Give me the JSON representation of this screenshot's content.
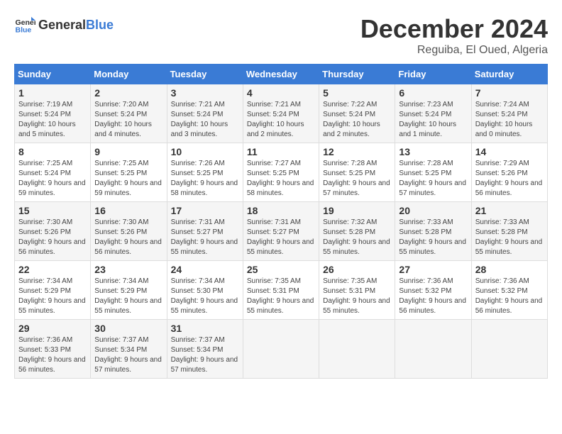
{
  "logo": {
    "general": "General",
    "blue": "Blue"
  },
  "title": "December 2024",
  "subtitle": "Reguiba, El Oued, Algeria",
  "days_header": [
    "Sunday",
    "Monday",
    "Tuesday",
    "Wednesday",
    "Thursday",
    "Friday",
    "Saturday"
  ],
  "weeks": [
    [
      {
        "day": "1",
        "sunrise": "7:19 AM",
        "sunset": "5:24 PM",
        "daylight": "10 hours and 5 minutes."
      },
      {
        "day": "2",
        "sunrise": "7:20 AM",
        "sunset": "5:24 PM",
        "daylight": "10 hours and 4 minutes."
      },
      {
        "day": "3",
        "sunrise": "7:21 AM",
        "sunset": "5:24 PM",
        "daylight": "10 hours and 3 minutes."
      },
      {
        "day": "4",
        "sunrise": "7:21 AM",
        "sunset": "5:24 PM",
        "daylight": "10 hours and 2 minutes."
      },
      {
        "day": "5",
        "sunrise": "7:22 AM",
        "sunset": "5:24 PM",
        "daylight": "10 hours and 2 minutes."
      },
      {
        "day": "6",
        "sunrise": "7:23 AM",
        "sunset": "5:24 PM",
        "daylight": "10 hours and 1 minute."
      },
      {
        "day": "7",
        "sunrise": "7:24 AM",
        "sunset": "5:24 PM",
        "daylight": "10 hours and 0 minutes."
      }
    ],
    [
      {
        "day": "8",
        "sunrise": "7:25 AM",
        "sunset": "5:24 PM",
        "daylight": "9 hours and 59 minutes."
      },
      {
        "day": "9",
        "sunrise": "7:25 AM",
        "sunset": "5:25 PM",
        "daylight": "9 hours and 59 minutes."
      },
      {
        "day": "10",
        "sunrise": "7:26 AM",
        "sunset": "5:25 PM",
        "daylight": "9 hours and 58 minutes."
      },
      {
        "day": "11",
        "sunrise": "7:27 AM",
        "sunset": "5:25 PM",
        "daylight": "9 hours and 58 minutes."
      },
      {
        "day": "12",
        "sunrise": "7:28 AM",
        "sunset": "5:25 PM",
        "daylight": "9 hours and 57 minutes."
      },
      {
        "day": "13",
        "sunrise": "7:28 AM",
        "sunset": "5:25 PM",
        "daylight": "9 hours and 57 minutes."
      },
      {
        "day": "14",
        "sunrise": "7:29 AM",
        "sunset": "5:26 PM",
        "daylight": "9 hours and 56 minutes."
      }
    ],
    [
      {
        "day": "15",
        "sunrise": "7:30 AM",
        "sunset": "5:26 PM",
        "daylight": "9 hours and 56 minutes."
      },
      {
        "day": "16",
        "sunrise": "7:30 AM",
        "sunset": "5:26 PM",
        "daylight": "9 hours and 56 minutes."
      },
      {
        "day": "17",
        "sunrise": "7:31 AM",
        "sunset": "5:27 PM",
        "daylight": "9 hours and 55 minutes."
      },
      {
        "day": "18",
        "sunrise": "7:31 AM",
        "sunset": "5:27 PM",
        "daylight": "9 hours and 55 minutes."
      },
      {
        "day": "19",
        "sunrise": "7:32 AM",
        "sunset": "5:28 PM",
        "daylight": "9 hours and 55 minutes."
      },
      {
        "day": "20",
        "sunrise": "7:33 AM",
        "sunset": "5:28 PM",
        "daylight": "9 hours and 55 minutes."
      },
      {
        "day": "21",
        "sunrise": "7:33 AM",
        "sunset": "5:28 PM",
        "daylight": "9 hours and 55 minutes."
      }
    ],
    [
      {
        "day": "22",
        "sunrise": "7:34 AM",
        "sunset": "5:29 PM",
        "daylight": "9 hours and 55 minutes."
      },
      {
        "day": "23",
        "sunrise": "7:34 AM",
        "sunset": "5:29 PM",
        "daylight": "9 hours and 55 minutes."
      },
      {
        "day": "24",
        "sunrise": "7:34 AM",
        "sunset": "5:30 PM",
        "daylight": "9 hours and 55 minutes."
      },
      {
        "day": "25",
        "sunrise": "7:35 AM",
        "sunset": "5:31 PM",
        "daylight": "9 hours and 55 minutes."
      },
      {
        "day": "26",
        "sunrise": "7:35 AM",
        "sunset": "5:31 PM",
        "daylight": "9 hours and 55 minutes."
      },
      {
        "day": "27",
        "sunrise": "7:36 AM",
        "sunset": "5:32 PM",
        "daylight": "9 hours and 56 minutes."
      },
      {
        "day": "28",
        "sunrise": "7:36 AM",
        "sunset": "5:32 PM",
        "daylight": "9 hours and 56 minutes."
      }
    ],
    [
      {
        "day": "29",
        "sunrise": "7:36 AM",
        "sunset": "5:33 PM",
        "daylight": "9 hours and 56 minutes."
      },
      {
        "day": "30",
        "sunrise": "7:37 AM",
        "sunset": "5:34 PM",
        "daylight": "9 hours and 57 minutes."
      },
      {
        "day": "31",
        "sunrise": "7:37 AM",
        "sunset": "5:34 PM",
        "daylight": "9 hours and 57 minutes."
      },
      null,
      null,
      null,
      null
    ]
  ]
}
